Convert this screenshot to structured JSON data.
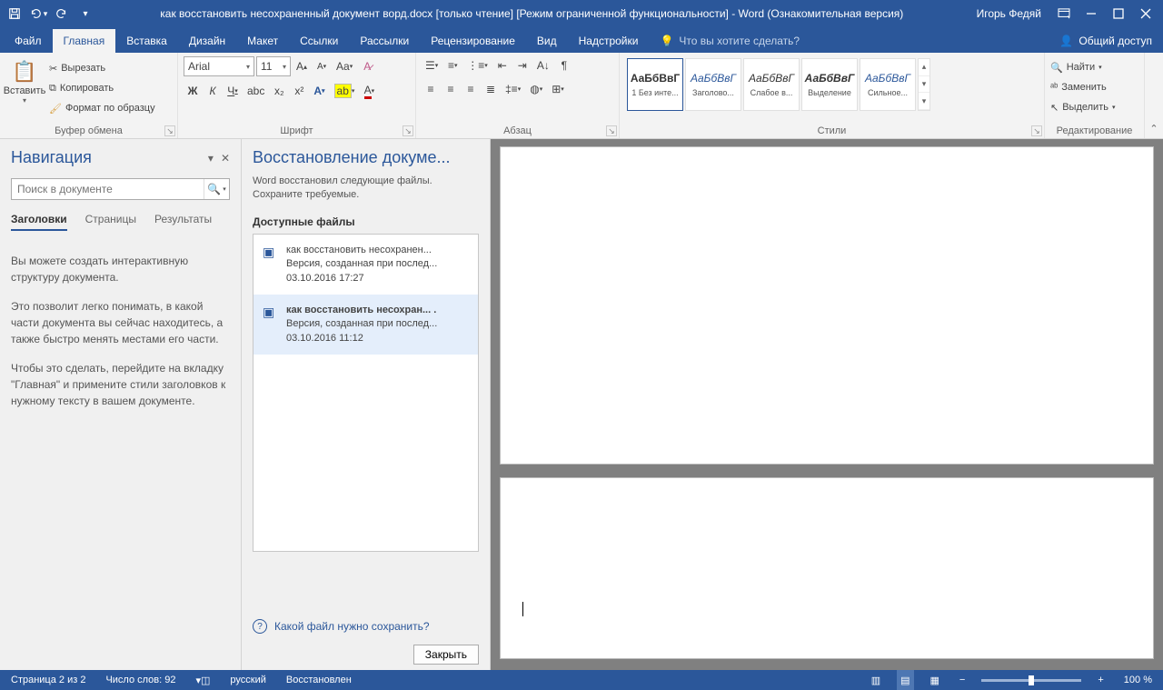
{
  "titlebar": {
    "title": "как восстановить несохраненный документ ворд.docx [только чтение] [Режим ограниченной функциональности] - Word (Ознакомительная версия)",
    "user": "Игорь Федяй"
  },
  "tabs": {
    "file": "Файл",
    "home": "Главная",
    "insert": "Вставка",
    "design": "Дизайн",
    "layout": "Макет",
    "references": "Ссылки",
    "mailings": "Рассылки",
    "review": "Рецензирование",
    "view": "Вид",
    "addins": "Надстройки",
    "tell_me": "Что вы хотите сделать?",
    "share": "Общий доступ"
  },
  "ribbon": {
    "clipboard": {
      "paste": "Вставить",
      "cut": "Вырезать",
      "copy": "Копировать",
      "format_painter": "Формат по образцу",
      "group": "Буфер обмена"
    },
    "font": {
      "name": "Arial",
      "size": "11",
      "group": "Шрифт"
    },
    "paragraph": {
      "group": "Абзац"
    },
    "styles": {
      "group": "Стили",
      "preview": "АаБбВвГ",
      "items": [
        "1 Без инте...",
        "Заголово...",
        "Слабое в...",
        "Выделение",
        "Сильное..."
      ],
      "blue_preview": "АаБбВвГ"
    },
    "editing": {
      "find": "Найти",
      "replace": "Заменить",
      "select": "Выделить",
      "group": "Редактирование"
    }
  },
  "navigation": {
    "title": "Навигация",
    "search_placeholder": "Поиск в документе",
    "tabs": {
      "headings": "Заголовки",
      "pages": "Страницы",
      "results": "Результаты"
    },
    "p1": "Вы можете создать интерактивную структуру документа.",
    "p2": "Это позволит легко понимать, в какой части документа вы сейчас находитесь, а также быстро менять местами его части.",
    "p3": "Чтобы это сделать, перейдите на вкладку \"Главная\" и примените стили заголовков к нужному тексту в вашем документе."
  },
  "recovery": {
    "title": "Восстановление докуме...",
    "subtitle": "Word восстановил следующие файлы. Сохраните требуемые.",
    "available": "Доступные файлы",
    "items": [
      {
        "name": "как восстановить несохранен...",
        "meta": "Версия, созданная при послед...",
        "date": "03.10.2016 17:27",
        "bold": false
      },
      {
        "name": "как восстановить несохран... .",
        "meta": "Версия, созданная при послед...",
        "date": "03.10.2016 11:12",
        "bold": true
      }
    ],
    "help": "Какой файл нужно сохранить?",
    "close": "Закрыть"
  },
  "status": {
    "page": "Страница 2 из 2",
    "words": "Число слов: 92",
    "lang": "русский",
    "recovered": "Восстановлен",
    "zoom": "100 %"
  }
}
